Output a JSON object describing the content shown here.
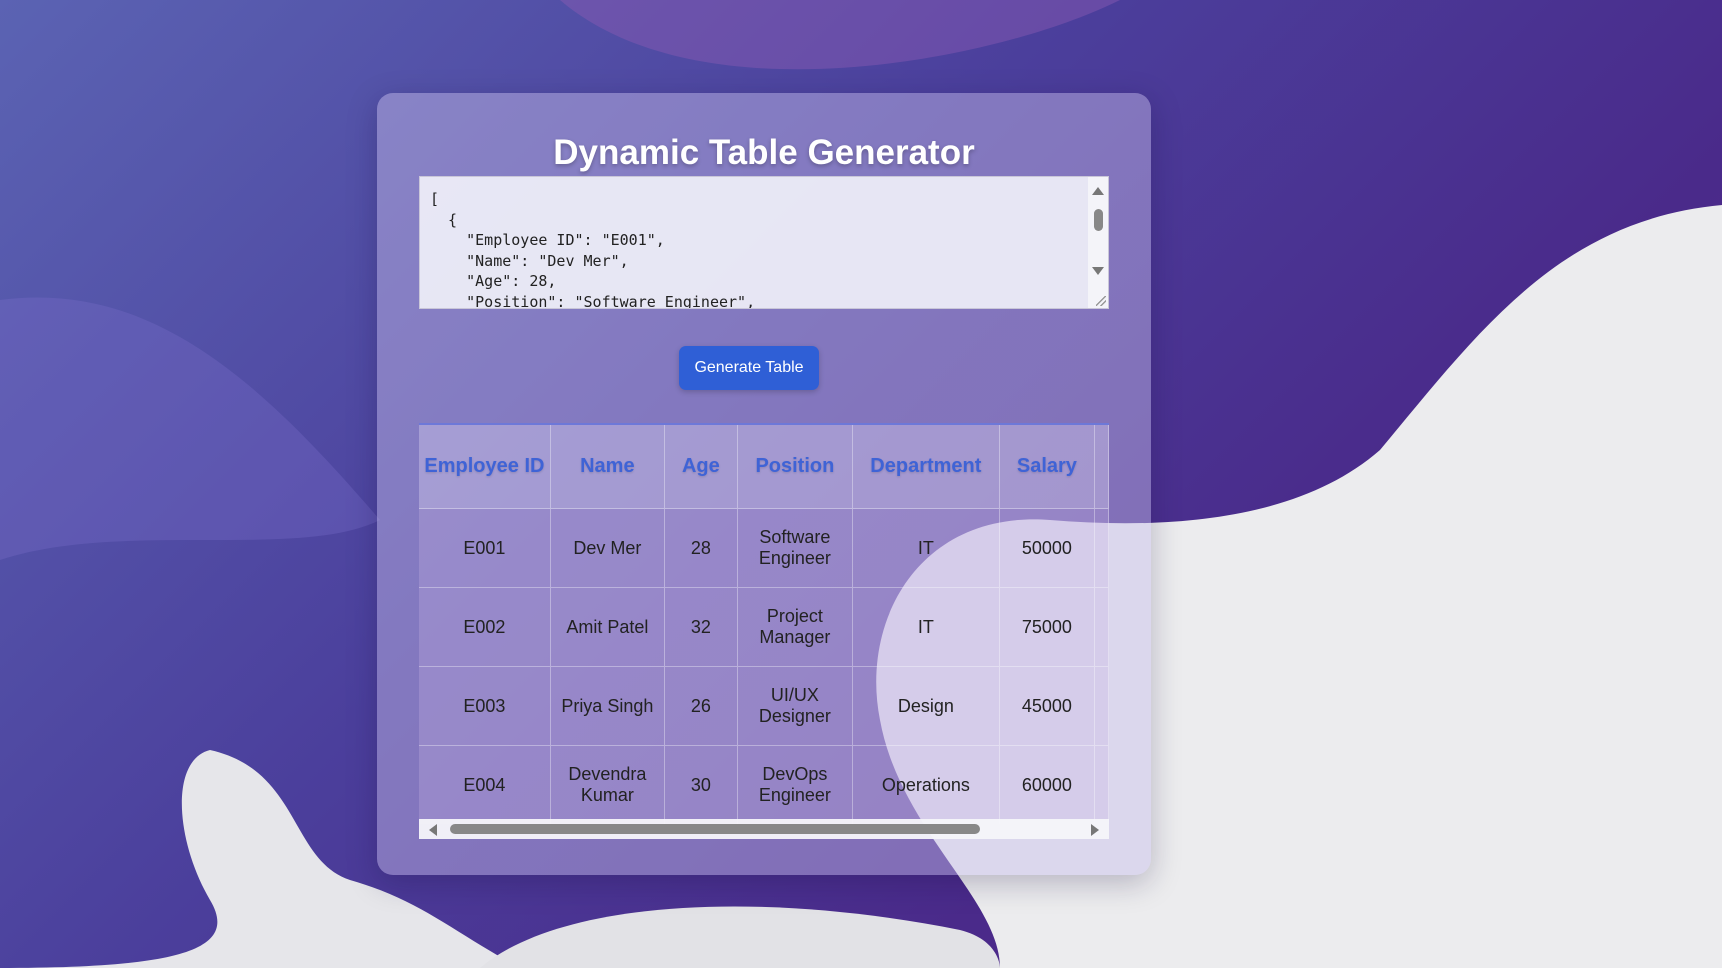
{
  "app": {
    "title": "Dynamic Table Generator",
    "json_input": "[\n  {\n    \"Employee ID\": \"E001\",\n    \"Name\": \"Dev Mer\",\n    \"Age\": 28,\n    \"Position\": \"Software Engineer\",",
    "generate_button_label": "Generate Table"
  },
  "table": {
    "headers": [
      "Employee ID",
      "Name",
      "Age",
      "Position",
      "Department",
      "Salary"
    ],
    "rows": [
      [
        "E001",
        "Dev Mer",
        "28",
        "Software Engineer",
        "IT",
        "50000"
      ],
      [
        "E002",
        "Amit Patel",
        "32",
        "Project Manager",
        "IT",
        "75000"
      ],
      [
        "E003",
        "Priya Singh",
        "26",
        "UI/UX Designer",
        "Design",
        "45000"
      ],
      [
        "E004",
        "Devendra Kumar",
        "30",
        "DevOps Engineer",
        "Operations",
        "60000"
      ]
    ]
  },
  "colors": {
    "accent": "#2f5fd6",
    "header_text": "#3f63d6"
  },
  "icons": [
    "scroll-up-icon",
    "scroll-down-icon",
    "resize-grip-icon",
    "scroll-left-icon",
    "scroll-right-icon"
  ]
}
